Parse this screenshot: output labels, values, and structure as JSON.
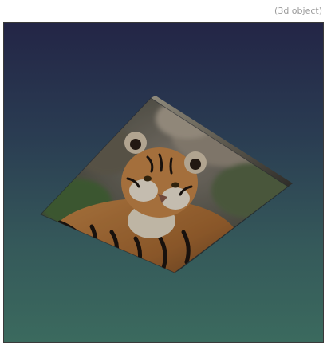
{
  "caption": "(3d object)",
  "scene": {
    "object": "tiger-photo-textured-box",
    "colors": {
      "sky_top": "#232546",
      "sky_bottom": "#3b6a5e",
      "border": "#3a3a3a"
    }
  }
}
